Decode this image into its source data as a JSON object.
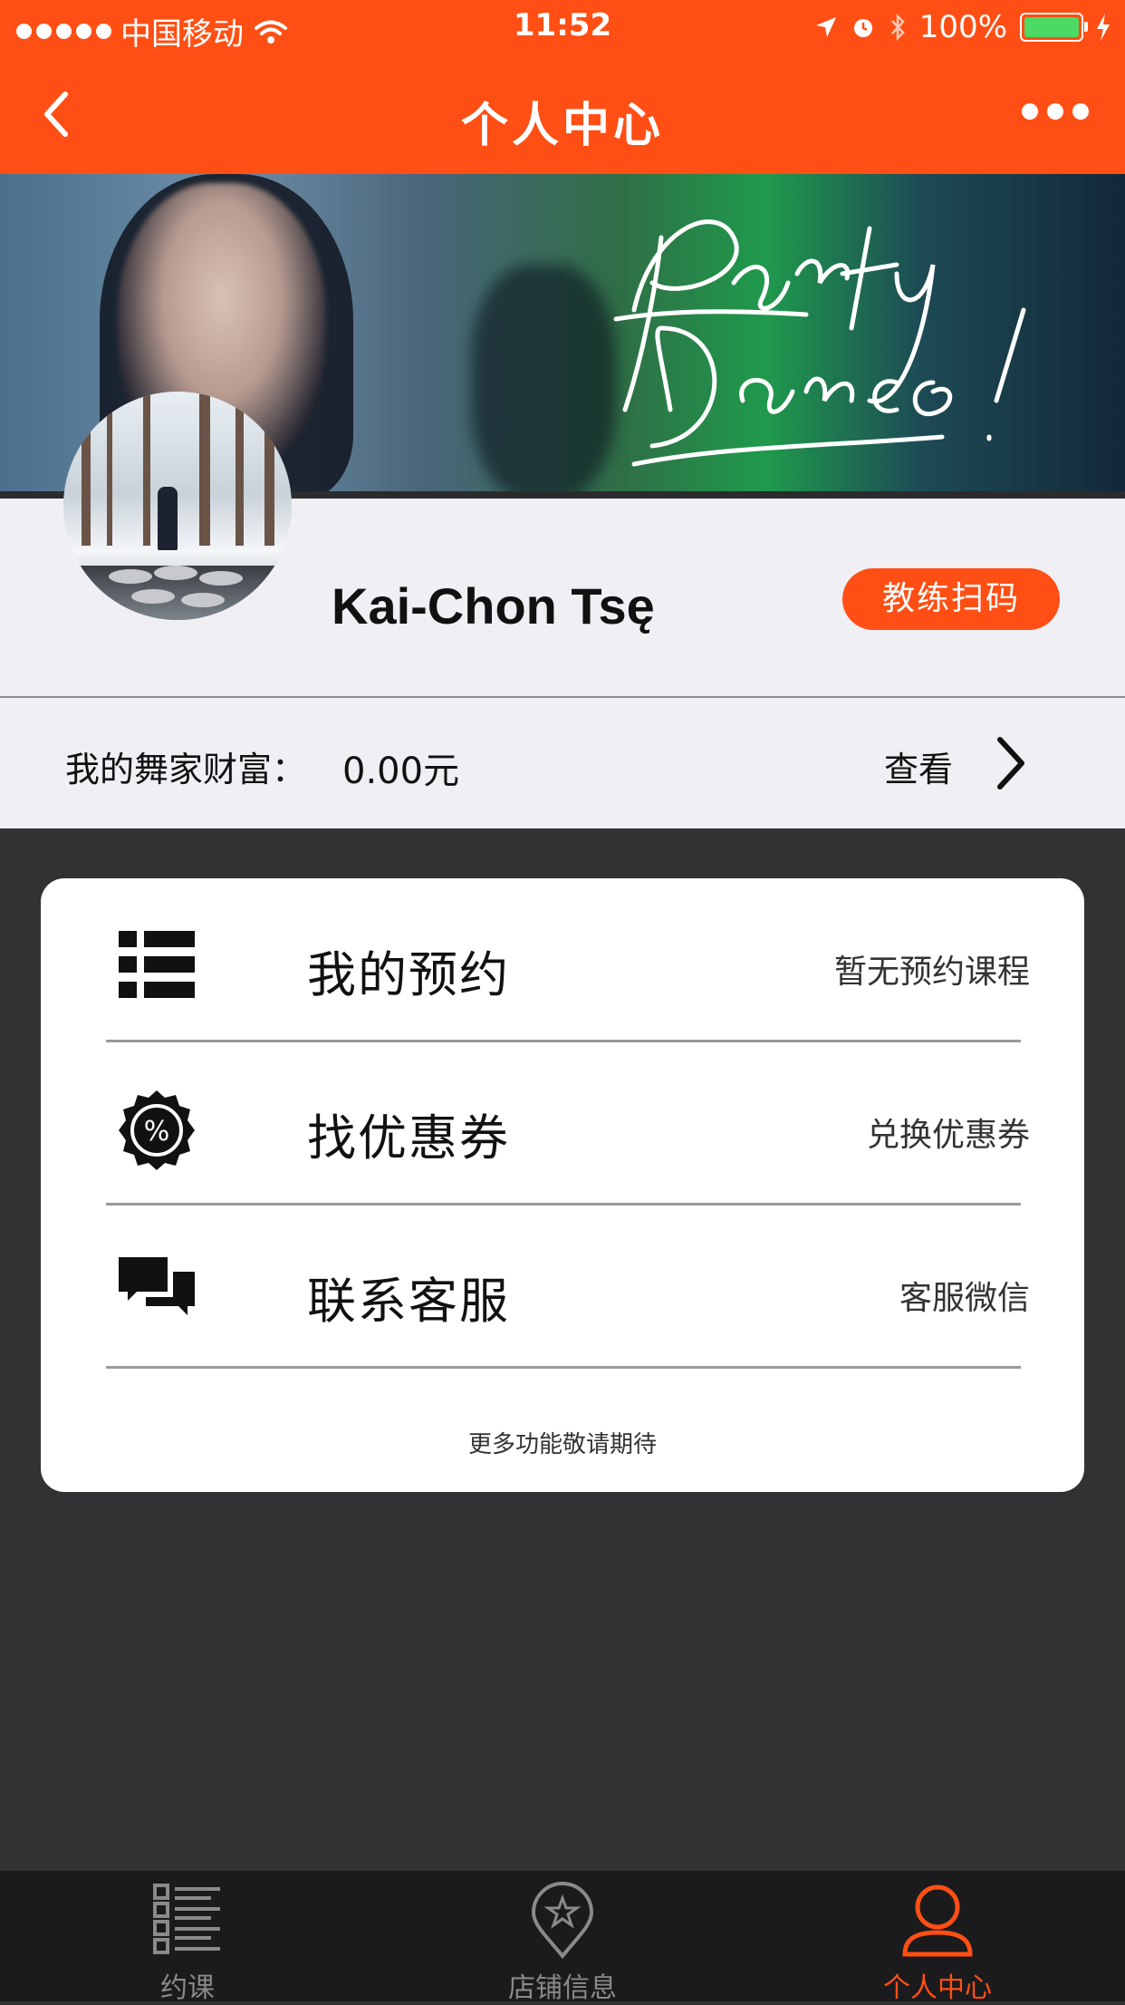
{
  "status_bar": {
    "carrier": "中国移动",
    "time": "11:52",
    "battery": "100%",
    "battery_level": 1.0
  },
  "nav": {
    "title": "个人中心",
    "back_icon": "chevron-left-icon",
    "more_icon": "more-dots-icon"
  },
  "banner": {
    "script_text": "Party Dance!"
  },
  "profile": {
    "username": "Kai-Chon Tsę",
    "coach_scan_button": "教练扫码"
  },
  "wealth": {
    "label": "我的舞家财富：",
    "value": "0.00元",
    "view_label": "查看"
  },
  "menu": {
    "items": [
      {
        "title": "我的预约",
        "sub": "暂无预约课程",
        "icon": "list-icon"
      },
      {
        "title": "找优惠券",
        "sub": "兑换优惠券",
        "icon": "coupon-percent-icon"
      },
      {
        "title": "联系客服",
        "sub": "客服微信",
        "icon": "chat-bubbles-icon"
      }
    ],
    "footer": "更多功能敬请期待"
  },
  "tabbar": {
    "tabs": [
      {
        "label": "约课",
        "icon": "schedule-list-icon",
        "active": false
      },
      {
        "label": "店铺信息",
        "icon": "store-location-icon",
        "active": false
      },
      {
        "label": "个人中心",
        "icon": "user-icon",
        "active": true
      }
    ]
  },
  "colors": {
    "accent": "#ff4f14",
    "background": "#323234",
    "panel": "#efeff4",
    "battery": "#4cd964"
  }
}
